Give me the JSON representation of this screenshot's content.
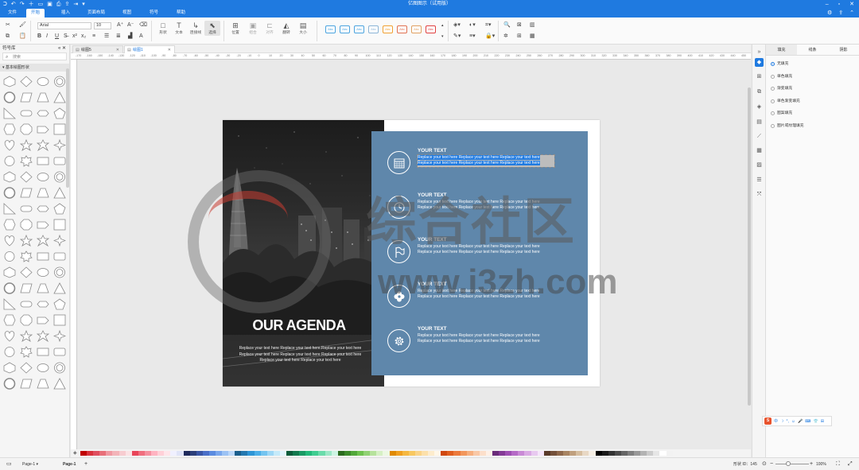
{
  "titlebar": {
    "title": "亿图图示（试用版）",
    "quick_icons": [
      "app-logo-icon",
      "undo-icon",
      "redo-icon",
      "new-icon",
      "open-icon",
      "save-icon",
      "print-icon",
      "export-icon",
      "share-icon",
      "more-icon"
    ],
    "window_controls": [
      "minimize-icon",
      "maximize-icon",
      "close-icon"
    ]
  },
  "menu": {
    "items": [
      "文件",
      "开始",
      "插入",
      "页面布局",
      "视图",
      "符号",
      "帮助"
    ],
    "active": "开始"
  },
  "ribbon": {
    "font_name": "Arial",
    "font_size": "10",
    "tools": [
      {
        "label": "形状",
        "icon": "shape-icon"
      },
      {
        "label": "文本",
        "icon": "text-icon"
      },
      {
        "label": "连接线",
        "icon": "connector-icon"
      },
      {
        "label": "选择",
        "icon": "select-icon"
      },
      {
        "label": "位置",
        "icon": "position-icon"
      },
      {
        "label": "组合",
        "icon": "group-icon"
      },
      {
        "label": "对齐",
        "icon": "align-icon"
      },
      {
        "label": "翻转",
        "icon": "flip-icon"
      },
      {
        "label": "大小",
        "icon": "size-icon"
      }
    ],
    "style_boxes": [
      "Abc",
      "Abc",
      "Abc",
      "Abc",
      "Abc",
      "Abc",
      "Abc",
      "Abc"
    ],
    "style_colors": [
      "#4aa3df",
      "#4aa3df",
      "#4aa3df",
      "#8ab4d6",
      "#f0a030",
      "#e07050",
      "#e0a060",
      "#e04040"
    ]
  },
  "leftpanel": {
    "title": "符号库",
    "search_placeholder": "搜索",
    "category": "基本绘图形状"
  },
  "doc_tabs": [
    {
      "label": "绘图5",
      "active": false
    },
    {
      "label": "绘图1",
      "active": true
    }
  ],
  "ruler_labels": [
    "-170",
    "-160",
    "-150",
    "-140",
    "-130",
    "-120",
    "-110",
    "-100",
    "-90",
    "-80",
    "-70",
    "-60",
    "-50",
    "-40",
    "-30",
    "-20",
    "-10",
    "0",
    "10",
    "20",
    "30",
    "40",
    "50",
    "60",
    "70",
    "80",
    "90",
    "100",
    "110",
    "120",
    "130",
    "140",
    "150",
    "160",
    "170",
    "180",
    "190",
    "200",
    "210",
    "220",
    "230",
    "240",
    "250",
    "260",
    "270",
    "280",
    "290",
    "300",
    "310",
    "320",
    "330",
    "340",
    "350",
    "360",
    "370",
    "380",
    "390",
    "400",
    "410",
    "420",
    "430",
    "440",
    "450"
  ],
  "slide": {
    "title": "OUR AGENDA",
    "body": "Replace your text here Replace your text here.Replace your text here Replace your text here Replace your text here Replace your text here Replace your text here Replace your text here",
    "items": [
      {
        "title": "YOUR TEXT",
        "text": "Replace your text here Replace your text here Replace your text here Replace your text here Replace your text here Replace your text here",
        "icon": "calendar-icon",
        "selected": true
      },
      {
        "title": "YOUR TEXT",
        "text": "Replace your text here Replace your text here Replace your text here Replace your text here Replace your text here Replace your text here",
        "icon": "clock-icon",
        "selected": false
      },
      {
        "title": "YOUR TEXT",
        "text": "Replace your text here Replace your text here Replace your text here Replace your text here Replace your text here Replace your text here",
        "icon": "flag-icon",
        "selected": false
      },
      {
        "title": "YOUR TEXT",
        "text": "Replace your text here Replace your text here Replace your text here Replace your text here Replace your text here Replace your text here",
        "icon": "flower-icon",
        "selected": false
      },
      {
        "title": "YOUR TEXT",
        "text": "Replace your text here Replace your text here Replace your text here Replace your text here Replace your text here Replace your text here",
        "icon": "gear-icon",
        "selected": false
      }
    ],
    "blue": "#5f87ab"
  },
  "watermark": {
    "text": "综合社区",
    "url": "www.i3zh.com"
  },
  "rightpanel": {
    "tabs": [
      "填充",
      "线条",
      "阴影"
    ],
    "active_tab": "填充",
    "fill_options": [
      "无填充",
      "单色填充",
      "渐变填充",
      "单色渐变填充",
      "图案填充",
      "图片或纹理填充"
    ],
    "selected_option": "无填充",
    "strip_icons": [
      "fill-icon",
      "grid-icon",
      "layers-icon",
      "page-icon",
      "outline-icon",
      "chart-icon",
      "table-icon",
      "image-icon",
      "list-icon",
      "fullscreen-icon"
    ]
  },
  "ime": [
    "中",
    "☽",
    "°,",
    "☺",
    "🎤",
    "⌨",
    "👕",
    "⊞"
  ],
  "palette": [
    "#c00000",
    "#d9323c",
    "#e04f5f",
    "#e8707a",
    "#f09aa3",
    "#f3b4b9",
    "#f7ccd0",
    "#fbe3e5",
    "#e9455a",
    "#f06f7f",
    "#f591a0",
    "#ffb3c1",
    "#ffd0d8",
    "#ffe5ea",
    "#f0f0ff",
    "#e0e4f8",
    "#1f2a5c",
    "#2c3e7a",
    "#3a56a5",
    "#4a6fc8",
    "#5b8be0",
    "#7aa7ec",
    "#9cc2f4",
    "#bcd8f9",
    "#1a5e8c",
    "#2478b0",
    "#2e95d6",
    "#4cafe8",
    "#74c4f0",
    "#9ed8f6",
    "#c5eafa",
    "#e2f5fd",
    "#0c5c3b",
    "#137a4f",
    "#1a9a64",
    "#23b97a",
    "#3fcd91",
    "#6bdcab",
    "#9de8c7",
    "#cdf4e3",
    "#2c6b1f",
    "#3d8a2b",
    "#52a83a",
    "#6fc24f",
    "#92d274",
    "#b6e29c",
    "#d6f0c4",
    "#ecf8e2",
    "#e08a00",
    "#f0a020",
    "#f6b840",
    "#f8c860",
    "#fad488",
    "#fce0aa",
    "#fdeccc",
    "#fff7e8",
    "#d04810",
    "#e05f20",
    "#ec7a3c",
    "#f2975c",
    "#f6b080",
    "#f9c8a6",
    "#fcdfca",
    "#fef0e6",
    "#6a2c7a",
    "#843a96",
    "#9e4fb2",
    "#b56ac6",
    "#c98ad6",
    "#daaae4",
    "#e8c9f0",
    "#f5e6fa",
    "#5a3a2a",
    "#74503a",
    "#8e684c",
    "#a88462",
    "#c0a07e",
    "#d6bea0",
    "#e8d8c4",
    "#f5eee4",
    "#000000",
    "#1a1a1a",
    "#333333",
    "#4d4d4d",
    "#666666",
    "#808080",
    "#999999",
    "#b3b3b3",
    "#cccccc",
    "#e6e6e6",
    "#ffffff",
    "#f2f2f2"
  ],
  "status": {
    "page_selector": "Page-1",
    "page_tab": "Page-1",
    "shape_id": "形状 ID：145",
    "zoom": "100%"
  }
}
